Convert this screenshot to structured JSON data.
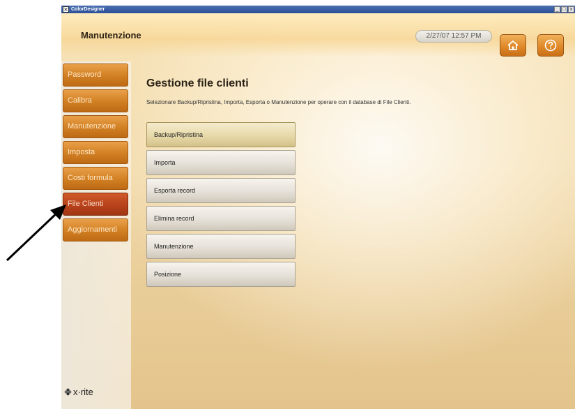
{
  "window": {
    "app_title": "ColorDesigner",
    "min_label": "_",
    "max_label": "□",
    "close_label": "x"
  },
  "header": {
    "section_title": "Manutenzione",
    "datetime": "2/27/07 12:57 PM",
    "home_icon": "home-icon",
    "help_icon": "help-icon"
  },
  "sidebar": {
    "items": [
      {
        "label": "Password",
        "active": false
      },
      {
        "label": "Calibra",
        "active": false
      },
      {
        "label": "Manutenzione",
        "active": false
      },
      {
        "label": "Imposta",
        "active": false
      },
      {
        "label": "Costi formula",
        "active": false
      },
      {
        "label": "File Clienti",
        "active": true
      },
      {
        "label": "Aggiornamenti",
        "active": false
      }
    ],
    "brand": "x·rite"
  },
  "main": {
    "heading": "Gestione file clienti",
    "description": "Selezionare Backup/Ripristina, Importa, Esporta o Manutenzione per operare con il database di File Clienti.",
    "buttons": [
      {
        "label": "Backup/Ripristina",
        "selected": true
      },
      {
        "label": "Importa",
        "selected": false
      },
      {
        "label": "Esporta record",
        "selected": false
      },
      {
        "label": "Elimina record",
        "selected": false
      },
      {
        "label": "Manutenzione",
        "selected": false
      },
      {
        "label": "Posizione",
        "selected": false
      }
    ]
  },
  "colors": {
    "nav_orange": "#d48225",
    "nav_active": "#b8421b",
    "header_button": "#e08a2a",
    "arrow": "#000000"
  }
}
